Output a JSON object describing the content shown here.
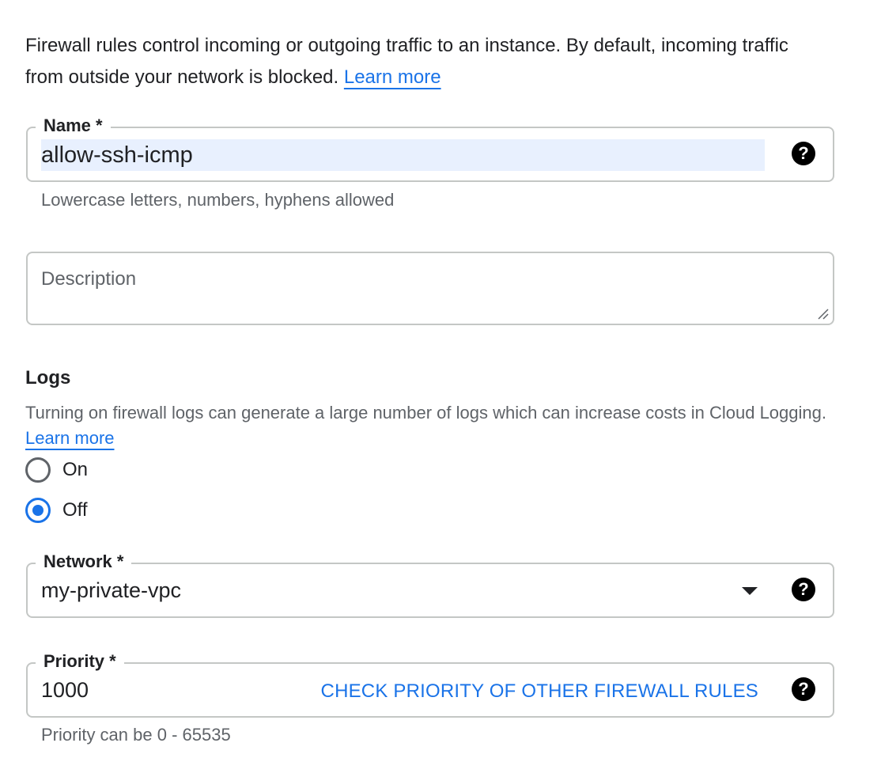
{
  "intro": {
    "text": "Firewall rules control incoming or outgoing traffic to an instance. By default, incoming traffic from outside your network is blocked.",
    "link": "Learn more"
  },
  "name_field": {
    "label": "Name *",
    "value": "allow-ssh-icmp",
    "hint": "Lowercase letters, numbers, hyphens allowed",
    "help": "?"
  },
  "description_field": {
    "placeholder": "Description"
  },
  "logs": {
    "title": "Logs",
    "text": "Turning on firewall logs can generate a large number of logs which can increase costs in Cloud Logging.",
    "link": "Learn more",
    "options": [
      {
        "label": "On",
        "selected": false
      },
      {
        "label": "Off",
        "selected": true
      }
    ]
  },
  "network_field": {
    "label": "Network *",
    "value": "my-private-vpc",
    "help": "?"
  },
  "priority_field": {
    "label": "Priority *",
    "value": "1000",
    "action": "CHECK PRIORITY OF OTHER FIREWALL RULES",
    "hint": "Priority can be 0 - 65535",
    "help": "?"
  },
  "colors": {
    "accent": "#1a73e8",
    "border": "#c4c7c5",
    "selection": "#e8f0fe"
  }
}
